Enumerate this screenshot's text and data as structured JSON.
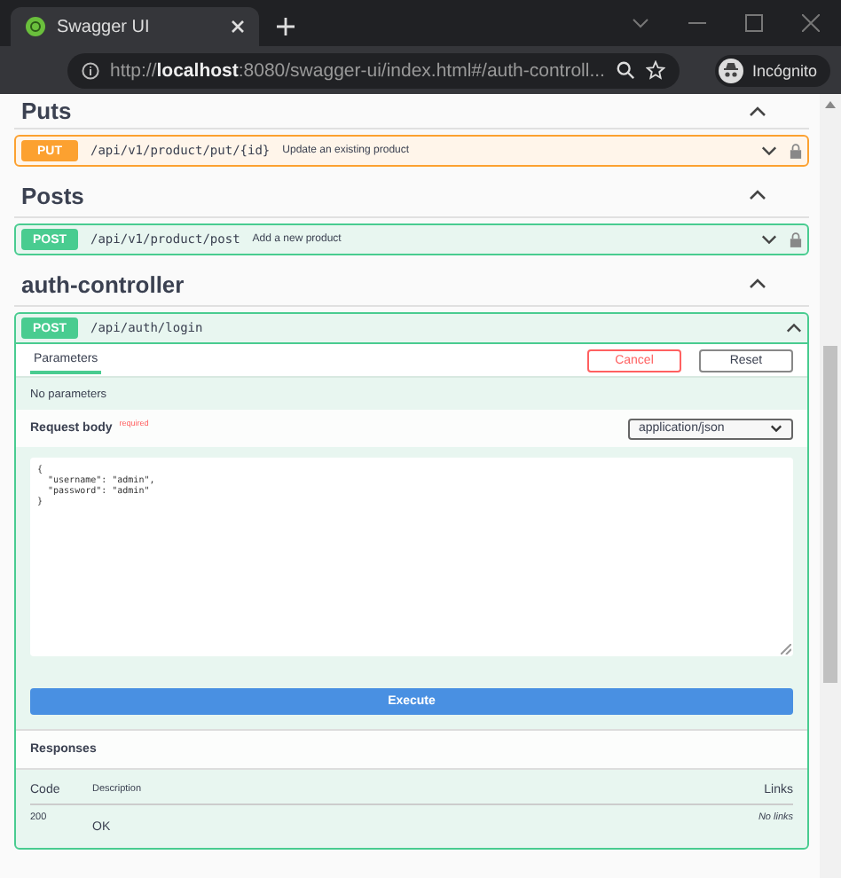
{
  "browser": {
    "tab_title": "Swagger UI",
    "url": "http://**localhost**:8080/swagger-ui/index.html#/auth-controll...",
    "profile": "Incógnito"
  },
  "sections": [
    {
      "title": "Puts",
      "expanded": true,
      "operations": [
        {
          "method": "PUT",
          "path": "/api/v1/product/put/{id}",
          "summary": "Update an existing product",
          "expanded": false,
          "locked": true
        }
      ]
    },
    {
      "title": "Posts",
      "expanded": true,
      "operations": [
        {
          "method": "POST",
          "path": "/api/v1/product/post",
          "summary": "Add a new product",
          "expanded": false,
          "locked": true
        }
      ]
    },
    {
      "title": "auth-controller",
      "expanded": true,
      "operations": [
        {
          "method": "POST",
          "path": "/api/auth/login",
          "expanded": true,
          "locked": false
        }
      ]
    }
  ],
  "details": {
    "tabs": [
      {
        "label": "Parameters",
        "selected": true
      }
    ],
    "cancel": "Cancel",
    "reset": "Reset",
    "no_params": "No parameters",
    "request_body": "Request body",
    "required": "required",
    "content_type": "application/json",
    "body_lines": [
      "{",
      "  \"username\": \"admin\",",
      "  \"password\": \"admin\"",
      "}"
    ],
    "execute": "Execute",
    "responses_title": "Responses",
    "columns": [
      "Code",
      "Description",
      "Links"
    ],
    "rows": [
      {
        "code": "200",
        "description": "OK",
        "links": "No links"
      }
    ]
  }
}
